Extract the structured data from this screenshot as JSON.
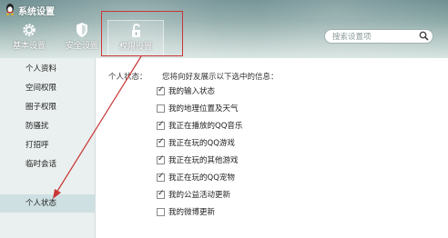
{
  "window": {
    "title": "系统设置"
  },
  "tabs": [
    {
      "label": "基本设置",
      "icon": "gear-icon"
    },
    {
      "label": "安全设置",
      "icon": "shield-icon"
    },
    {
      "label": "权限设置",
      "icon": "unlock-icon",
      "active": true
    }
  ],
  "search": {
    "placeholder": "搜索设置项"
  },
  "sidebar": {
    "items": [
      {
        "label": "个人资料"
      },
      {
        "label": "空间权限"
      },
      {
        "label": "圈子权限"
      },
      {
        "label": "防骚扰"
      },
      {
        "label": "打招呼"
      },
      {
        "label": "临时会话"
      },
      {
        "label": "个人状态",
        "active": true
      }
    ]
  },
  "content": {
    "section_label": "个人状态：",
    "description": "您将向好友展示以下选中的信息：",
    "options": [
      {
        "label": "我的输入状态",
        "checked": true
      },
      {
        "label": "我的地理位置及天气",
        "checked": false
      },
      {
        "label": "我正在播放的QQ音乐",
        "checked": true
      },
      {
        "label": "我正在玩的QQ游戏",
        "checked": true
      },
      {
        "label": "我正在玩的其他游戏",
        "checked": true
      },
      {
        "label": "我正在玩的QQ宠物",
        "checked": true
      },
      {
        "label": "我的公益活动更新",
        "checked": true
      },
      {
        "label": "我的微博更新",
        "checked": false
      }
    ]
  },
  "colors": {
    "annotation": "#c93636",
    "sidebar_active": "#cfe0e2"
  }
}
